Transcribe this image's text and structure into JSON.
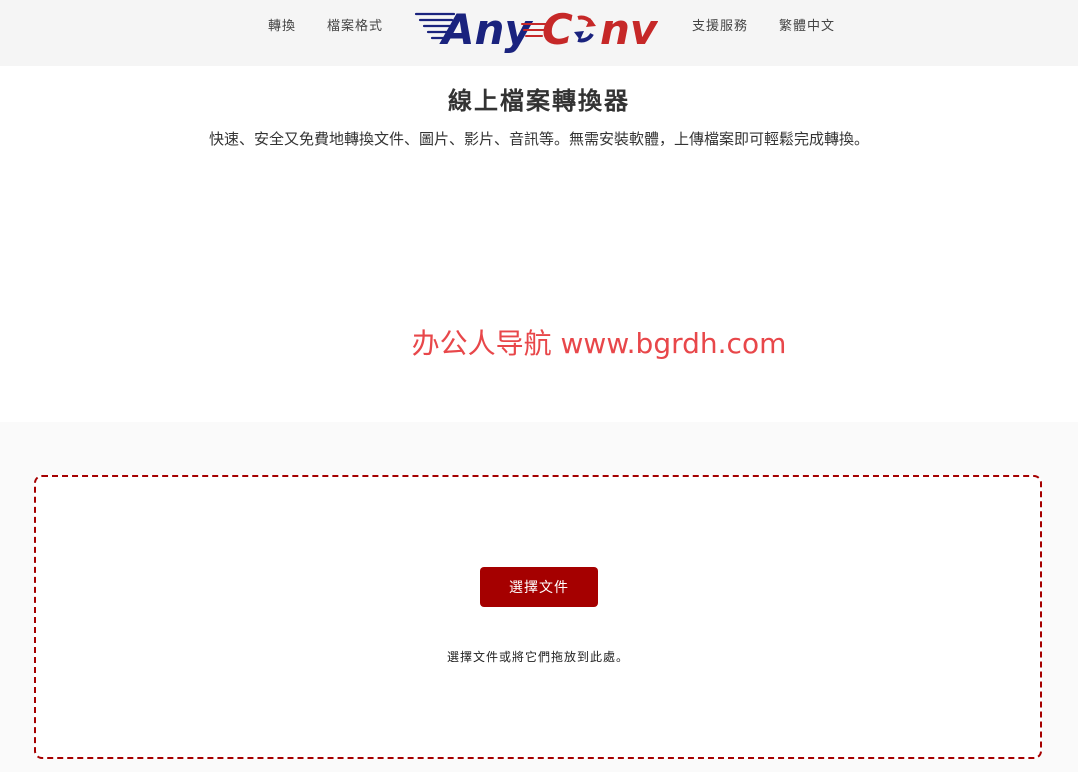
{
  "header": {
    "nav_left": [
      {
        "label": "轉換"
      },
      {
        "label": "檔案格式"
      }
    ],
    "nav_right": [
      {
        "label": "支援服務"
      },
      {
        "label": "繁體中文"
      }
    ],
    "logo": {
      "part1": "Any",
      "part2_c": "C",
      "part2_rest": "nv",
      "colors": {
        "navy": "#1a237e",
        "red": "#c62828"
      }
    }
  },
  "hero": {
    "title": "線上檔案轉換器",
    "subtitle": "快速、安全又免費地轉換文件、圖片、影片、音訊等。無需安裝軟體，上傳檔案即可輕鬆完成轉換。"
  },
  "watermark": {
    "text": "办公人导航 www.bgrdh.com",
    "color": "#e8474a"
  },
  "upload": {
    "button_label": "選擇文件",
    "hint": "選擇文件或將它們拖放到此處。",
    "accent": "#a50000"
  }
}
